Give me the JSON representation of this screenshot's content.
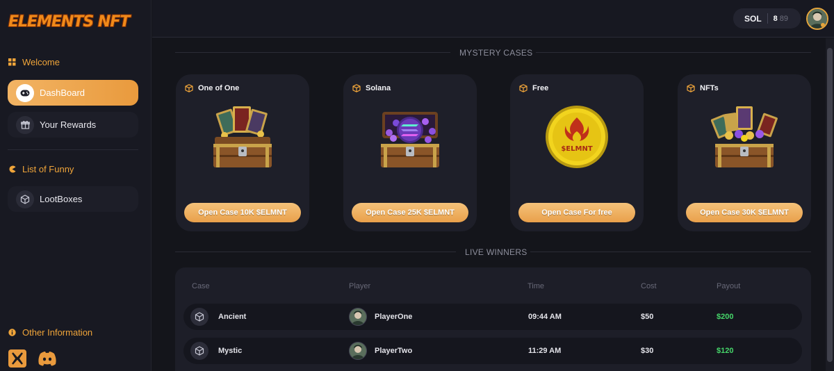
{
  "brand": {
    "logo_text": "ELEMENTS NFT"
  },
  "sidebar": {
    "welcome": "Welcome",
    "items_top": [
      {
        "label": "DashBoard",
        "icon": "gamepad-icon",
        "active": true
      },
      {
        "label": "Your Rewards",
        "icon": "gift-icon",
        "active": false
      }
    ],
    "funny": "List of Funny",
    "items_mid": [
      {
        "label": "LootBoxes",
        "icon": "cube-icon",
        "active": false
      }
    ],
    "other": "Other Information",
    "social": [
      "x-icon",
      "discord-icon"
    ]
  },
  "topbar": {
    "currency": "SOL",
    "balance_main": "8",
    "balance_sub": "89"
  },
  "mystery": {
    "title": "MYSTERY CASES",
    "cases": [
      {
        "name": "One of One",
        "button": "Open Case 10K $ELMNT",
        "art": "treasure-chest-cards"
      },
      {
        "name": "Solana",
        "button": "Open Case 25K $ELMNT",
        "art": "treasure-chest-solana"
      },
      {
        "name": "Free",
        "button": "Open Case For free",
        "art": "selmnt-coin"
      },
      {
        "name": "NFTs",
        "button": "Open Case 30K $ELMNT",
        "art": "treasure-chest-nfts"
      }
    ],
    "coin_text": "$ELMNT"
  },
  "winners": {
    "title": "LIVE WINNERS",
    "columns": [
      "Case",
      "Player",
      "Time",
      "Cost",
      "Payout"
    ],
    "rows": [
      {
        "case": "Ancient",
        "player": "PlayerOne",
        "time": "09:44 AM",
        "cost": "$50",
        "payout": "$200"
      },
      {
        "case": "Mystic",
        "player": "PlayerTwo",
        "time": "11:29 AM",
        "cost": "$30",
        "payout": "$120"
      }
    ]
  },
  "colors": {
    "accent": "#e99a3d",
    "payout_green": "#46d66a",
    "bg": "#14151b"
  }
}
